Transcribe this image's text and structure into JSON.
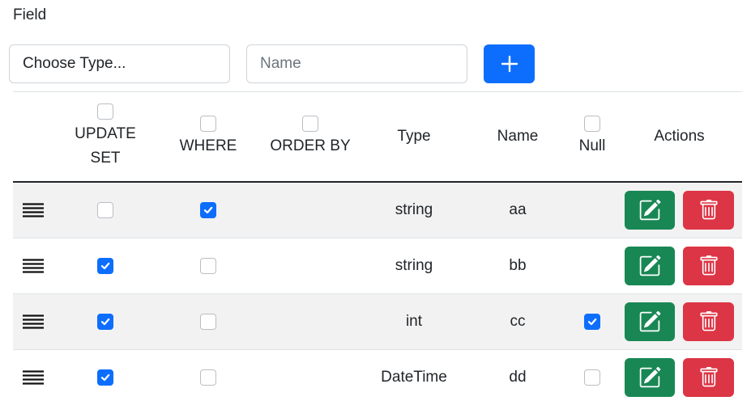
{
  "form": {
    "field_label": "Field",
    "type_select_value": "Choose Type...",
    "name_placeholder": "Name",
    "add_icon": "plus-icon"
  },
  "table": {
    "headers": {
      "update_set": "UPDATE SET",
      "where": "WHERE",
      "order_by": "ORDER BY",
      "type": "Type",
      "name": "Name",
      "null": "Null",
      "actions": "Actions"
    },
    "rows": [
      {
        "update_set": false,
        "where": true,
        "type": "string",
        "name": "aa",
        "null_shown": false,
        "null": false
      },
      {
        "update_set": true,
        "where": false,
        "type": "string",
        "name": "bb",
        "null_shown": false,
        "null": false
      },
      {
        "update_set": true,
        "where": false,
        "type": "int",
        "name": "cc",
        "null_shown": true,
        "null": true
      },
      {
        "update_set": true,
        "where": false,
        "type": "DateTime",
        "name": "dd",
        "null_shown": true,
        "null": false
      }
    ]
  },
  "colors": {
    "primary": "#0d6efd",
    "success": "#198754",
    "danger": "#dc3545"
  },
  "icons": {
    "drag": "drag-handle-icon",
    "edit": "edit-icon",
    "delete": "trash-icon"
  }
}
